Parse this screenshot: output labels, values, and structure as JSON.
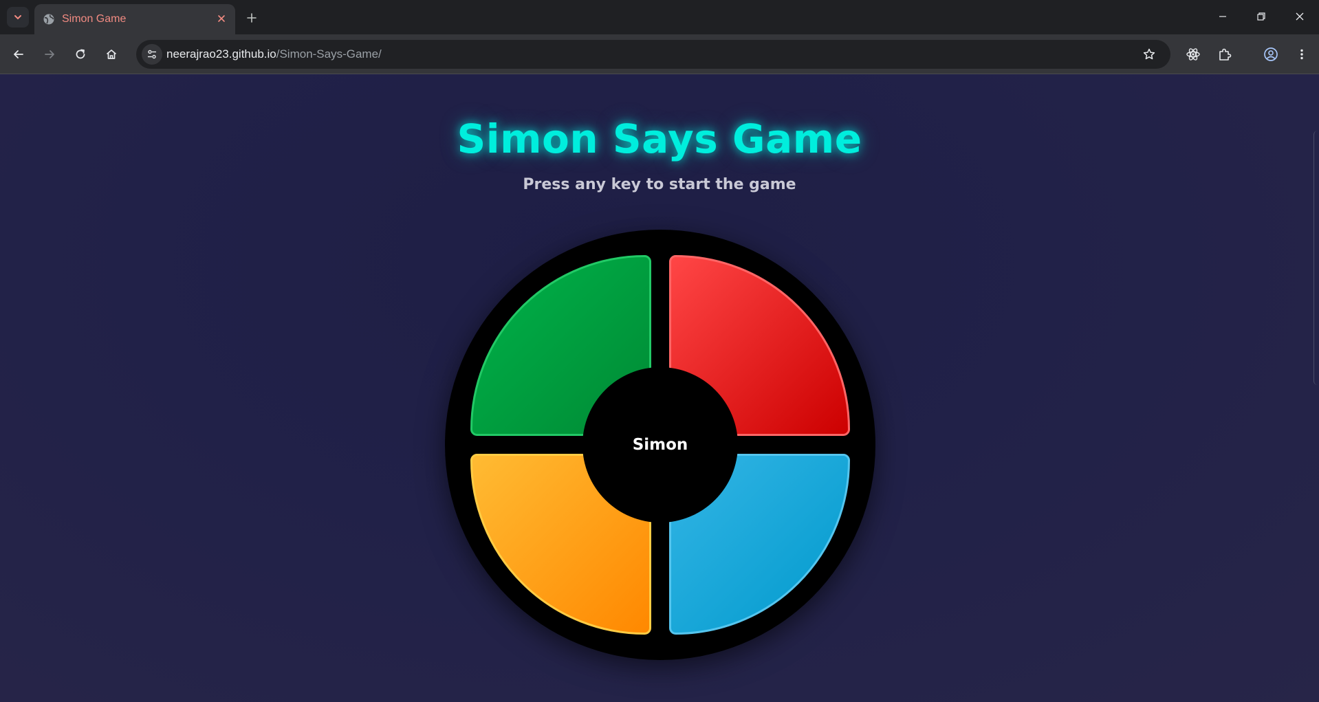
{
  "browser": {
    "tab": {
      "title": "Simon Game"
    },
    "address": {
      "host": "neerajrao23.github.io",
      "path": "/Simon-Says-Game/"
    }
  },
  "page": {
    "title": "Simon Says Game",
    "subtitle": "Press any key to start the game",
    "board": {
      "center_label": "Simon",
      "pads": [
        {
          "color": "green",
          "hex": "#00a541"
        },
        {
          "color": "red",
          "hex": "#e60f0f"
        },
        {
          "color": "yellow",
          "hex": "#ffa21a"
        },
        {
          "color": "blue",
          "hex": "#19a7d9"
        }
      ]
    }
  },
  "colors": {
    "accent": "#00eedd",
    "page_bg": "#222248",
    "chrome_bg": "#35363a"
  }
}
